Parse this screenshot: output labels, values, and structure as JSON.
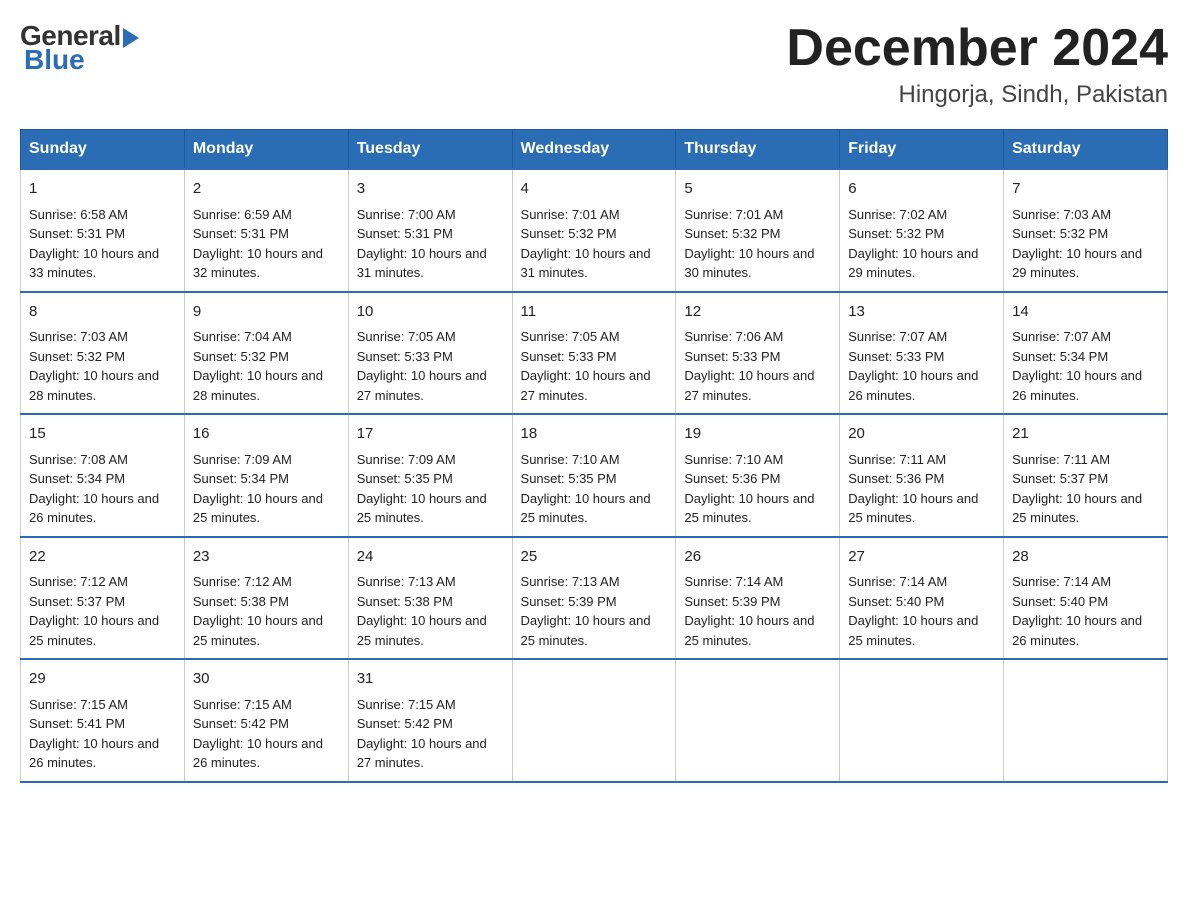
{
  "logo": {
    "general": "General",
    "blue": "Blue"
  },
  "title": {
    "month_year": "December 2024",
    "location": "Hingorja, Sindh, Pakistan"
  },
  "headers": [
    "Sunday",
    "Monday",
    "Tuesday",
    "Wednesday",
    "Thursday",
    "Friday",
    "Saturday"
  ],
  "weeks": [
    [
      {
        "day": "1",
        "sunrise": "6:58 AM",
        "sunset": "5:31 PM",
        "daylight": "10 hours and 33 minutes."
      },
      {
        "day": "2",
        "sunrise": "6:59 AM",
        "sunset": "5:31 PM",
        "daylight": "10 hours and 32 minutes."
      },
      {
        "day": "3",
        "sunrise": "7:00 AM",
        "sunset": "5:31 PM",
        "daylight": "10 hours and 31 minutes."
      },
      {
        "day": "4",
        "sunrise": "7:01 AM",
        "sunset": "5:32 PM",
        "daylight": "10 hours and 31 minutes."
      },
      {
        "day": "5",
        "sunrise": "7:01 AM",
        "sunset": "5:32 PM",
        "daylight": "10 hours and 30 minutes."
      },
      {
        "day": "6",
        "sunrise": "7:02 AM",
        "sunset": "5:32 PM",
        "daylight": "10 hours and 29 minutes."
      },
      {
        "day": "7",
        "sunrise": "7:03 AM",
        "sunset": "5:32 PM",
        "daylight": "10 hours and 29 minutes."
      }
    ],
    [
      {
        "day": "8",
        "sunrise": "7:03 AM",
        "sunset": "5:32 PM",
        "daylight": "10 hours and 28 minutes."
      },
      {
        "day": "9",
        "sunrise": "7:04 AM",
        "sunset": "5:32 PM",
        "daylight": "10 hours and 28 minutes."
      },
      {
        "day": "10",
        "sunrise": "7:05 AM",
        "sunset": "5:33 PM",
        "daylight": "10 hours and 27 minutes."
      },
      {
        "day": "11",
        "sunrise": "7:05 AM",
        "sunset": "5:33 PM",
        "daylight": "10 hours and 27 minutes."
      },
      {
        "day": "12",
        "sunrise": "7:06 AM",
        "sunset": "5:33 PM",
        "daylight": "10 hours and 27 minutes."
      },
      {
        "day": "13",
        "sunrise": "7:07 AM",
        "sunset": "5:33 PM",
        "daylight": "10 hours and 26 minutes."
      },
      {
        "day": "14",
        "sunrise": "7:07 AM",
        "sunset": "5:34 PM",
        "daylight": "10 hours and 26 minutes."
      }
    ],
    [
      {
        "day": "15",
        "sunrise": "7:08 AM",
        "sunset": "5:34 PM",
        "daylight": "10 hours and 26 minutes."
      },
      {
        "day": "16",
        "sunrise": "7:09 AM",
        "sunset": "5:34 PM",
        "daylight": "10 hours and 25 minutes."
      },
      {
        "day": "17",
        "sunrise": "7:09 AM",
        "sunset": "5:35 PM",
        "daylight": "10 hours and 25 minutes."
      },
      {
        "day": "18",
        "sunrise": "7:10 AM",
        "sunset": "5:35 PM",
        "daylight": "10 hours and 25 minutes."
      },
      {
        "day": "19",
        "sunrise": "7:10 AM",
        "sunset": "5:36 PM",
        "daylight": "10 hours and 25 minutes."
      },
      {
        "day": "20",
        "sunrise": "7:11 AM",
        "sunset": "5:36 PM",
        "daylight": "10 hours and 25 minutes."
      },
      {
        "day": "21",
        "sunrise": "7:11 AM",
        "sunset": "5:37 PM",
        "daylight": "10 hours and 25 minutes."
      }
    ],
    [
      {
        "day": "22",
        "sunrise": "7:12 AM",
        "sunset": "5:37 PM",
        "daylight": "10 hours and 25 minutes."
      },
      {
        "day": "23",
        "sunrise": "7:12 AM",
        "sunset": "5:38 PM",
        "daylight": "10 hours and 25 minutes."
      },
      {
        "day": "24",
        "sunrise": "7:13 AM",
        "sunset": "5:38 PM",
        "daylight": "10 hours and 25 minutes."
      },
      {
        "day": "25",
        "sunrise": "7:13 AM",
        "sunset": "5:39 PM",
        "daylight": "10 hours and 25 minutes."
      },
      {
        "day": "26",
        "sunrise": "7:14 AM",
        "sunset": "5:39 PM",
        "daylight": "10 hours and 25 minutes."
      },
      {
        "day": "27",
        "sunrise": "7:14 AM",
        "sunset": "5:40 PM",
        "daylight": "10 hours and 25 minutes."
      },
      {
        "day": "28",
        "sunrise": "7:14 AM",
        "sunset": "5:40 PM",
        "daylight": "10 hours and 26 minutes."
      }
    ],
    [
      {
        "day": "29",
        "sunrise": "7:15 AM",
        "sunset": "5:41 PM",
        "daylight": "10 hours and 26 minutes."
      },
      {
        "day": "30",
        "sunrise": "7:15 AM",
        "sunset": "5:42 PM",
        "daylight": "10 hours and 26 minutes."
      },
      {
        "day": "31",
        "sunrise": "7:15 AM",
        "sunset": "5:42 PM",
        "daylight": "10 hours and 27 minutes."
      },
      null,
      null,
      null,
      null
    ]
  ],
  "labels": {
    "sunrise": "Sunrise:",
    "sunset": "Sunset:",
    "daylight": "Daylight:"
  }
}
